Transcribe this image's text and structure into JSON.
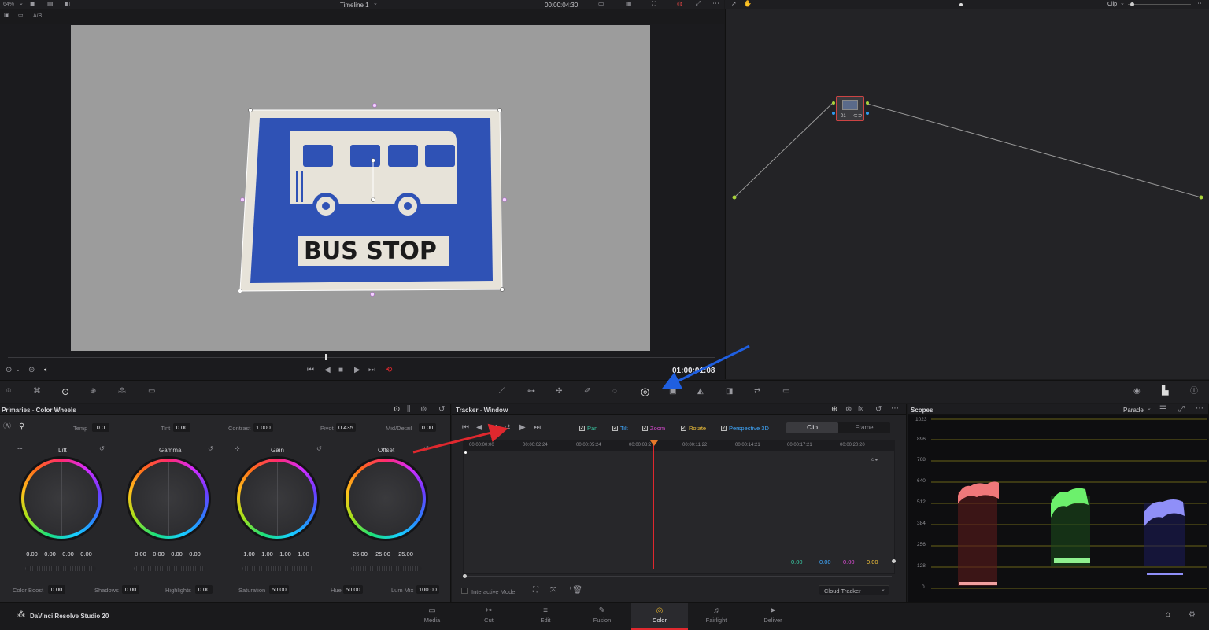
{
  "viewer": {
    "zoom": "64%",
    "timeline_name": "Timeline 1",
    "duration": "00:00:04:30",
    "ab_label": "A/B",
    "timecode": "01:00:01:08",
    "sign_text": "BUS STOP"
  },
  "nodes": {
    "mode": "Clip",
    "node_label": "01"
  },
  "primaries": {
    "title": "Primaries - Color Wheels",
    "temp_label": "Temp",
    "temp": "0.0",
    "tint_label": "Tint",
    "tint": "0.00",
    "contrast_label": "Contrast",
    "contrast": "1.000",
    "pivot_label": "Pivot",
    "pivot": "0.435",
    "middetail_label": "Mid/Detail",
    "middetail": "0.00",
    "wheels": [
      {
        "name": "Lift",
        "values": [
          "0.00",
          "0.00",
          "0.00",
          "0.00"
        ]
      },
      {
        "name": "Gamma",
        "values": [
          "0.00",
          "0.00",
          "0.00",
          "0.00"
        ]
      },
      {
        "name": "Gain",
        "values": [
          "1.00",
          "1.00",
          "1.00",
          "1.00"
        ]
      },
      {
        "name": "Offset",
        "values": [
          "25.00",
          "25.00",
          "25.00"
        ]
      }
    ],
    "colorboost_label": "Color Boost",
    "colorboost": "0.00",
    "shadows_label": "Shadows",
    "shadows": "0.00",
    "highlights_label": "Highlights",
    "highlights": "0.00",
    "saturation_label": "Saturation",
    "saturation": "50.00",
    "hue_label": "Hue",
    "hue": "50.00",
    "lummix_label": "Lum Mix",
    "lummix": "100.00"
  },
  "tracker": {
    "title": "Tracker - Window",
    "options": [
      {
        "label": "Pan",
        "color": "#39c9a4"
      },
      {
        "label": "Tilt",
        "color": "#3fa9ff"
      },
      {
        "label": "Zoom",
        "color": "#d94bd2"
      },
      {
        "label": "Rotate",
        "color": "#f2c23a"
      },
      {
        "label": "Perspective 3D",
        "color": "#3fa9ff"
      }
    ],
    "clip_tab": "Clip",
    "frame_tab": "Frame",
    "ruler": [
      "00:00:00:00",
      "00:00:02:24",
      "00:00:05:24",
      "00:00:08:2",
      "00:00:11:22",
      "00:00:14:21",
      "00:00:17:21",
      "00:00:20:20"
    ],
    "readouts": [
      {
        "value": "0.00",
        "color": "#39c9a4"
      },
      {
        "value": "0.00",
        "color": "#3fa9ff"
      },
      {
        "value": "0.00",
        "color": "#d94bd2"
      },
      {
        "value": "0.00",
        "color": "#f2c23a"
      }
    ],
    "interactive_mode": "Interactive Mode",
    "tracker_type": "Cloud Tracker"
  },
  "scopes": {
    "title": "Scopes",
    "mode": "Parade",
    "axis": [
      "1023",
      "896",
      "768",
      "640",
      "512",
      "384",
      "256",
      "128",
      "0"
    ]
  },
  "app": {
    "name": "DaVinci Resolve Studio 20",
    "pages": [
      {
        "label": "Media",
        "icon": "▭"
      },
      {
        "label": "Cut",
        "icon": "✂"
      },
      {
        "label": "Edit",
        "icon": "≡"
      },
      {
        "label": "Fusion",
        "icon": "✎"
      },
      {
        "label": "Color",
        "icon": "◎"
      },
      {
        "label": "Fairlight",
        "icon": "♫"
      },
      {
        "label": "Deliver",
        "icon": "➤"
      }
    ]
  },
  "colors": {
    "accent": "#e0282e",
    "arrow_blue": "#1f5fe0",
    "arrow_red": "#e0282e"
  }
}
